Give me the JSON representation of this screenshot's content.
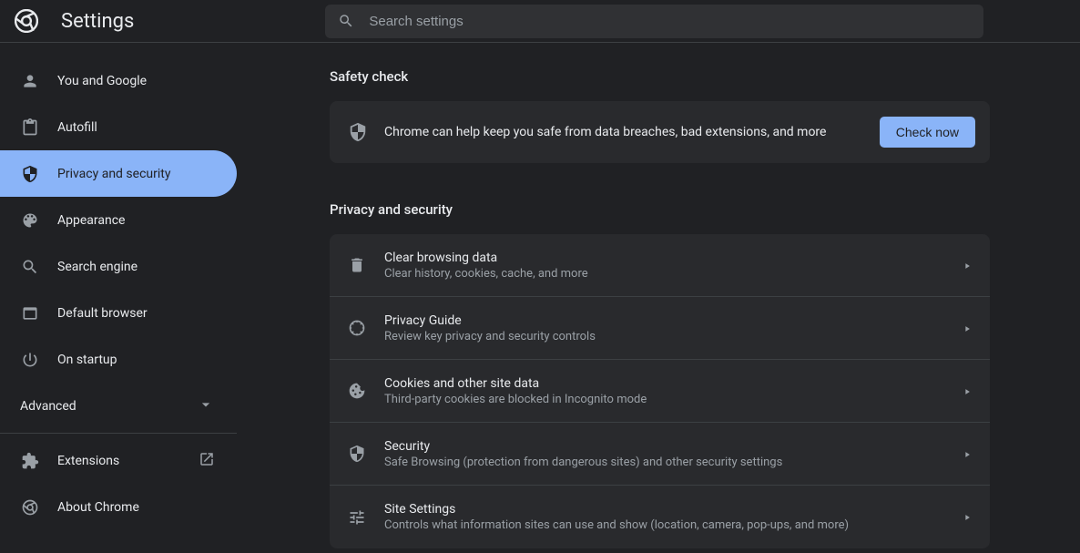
{
  "header": {
    "title": "Settings",
    "search_placeholder": "Search settings"
  },
  "sidebar": {
    "items": [
      {
        "label": "You and Google"
      },
      {
        "label": "Autofill"
      },
      {
        "label": "Privacy and security"
      },
      {
        "label": "Appearance"
      },
      {
        "label": "Search engine"
      },
      {
        "label": "Default browser"
      },
      {
        "label": "On startup"
      }
    ],
    "advanced_label": "Advanced",
    "extensions_label": "Extensions",
    "about_label": "About Chrome"
  },
  "safety": {
    "section_title": "Safety check",
    "text": "Chrome can help keep you safe from data breaches, bad extensions, and more",
    "button": "Check now"
  },
  "privacy": {
    "section_title": "Privacy and security",
    "rows": [
      {
        "title": "Clear browsing data",
        "sub": "Clear history, cookies, cache, and more"
      },
      {
        "title": "Privacy Guide",
        "sub": "Review key privacy and security controls"
      },
      {
        "title": "Cookies and other site data",
        "sub": "Third-party cookies are blocked in Incognito mode"
      },
      {
        "title": "Security",
        "sub": "Safe Browsing (protection from dangerous sites) and other security settings"
      },
      {
        "title": "Site Settings",
        "sub": "Controls what information sites can use and show (location, camera, pop-ups, and more)"
      }
    ]
  }
}
